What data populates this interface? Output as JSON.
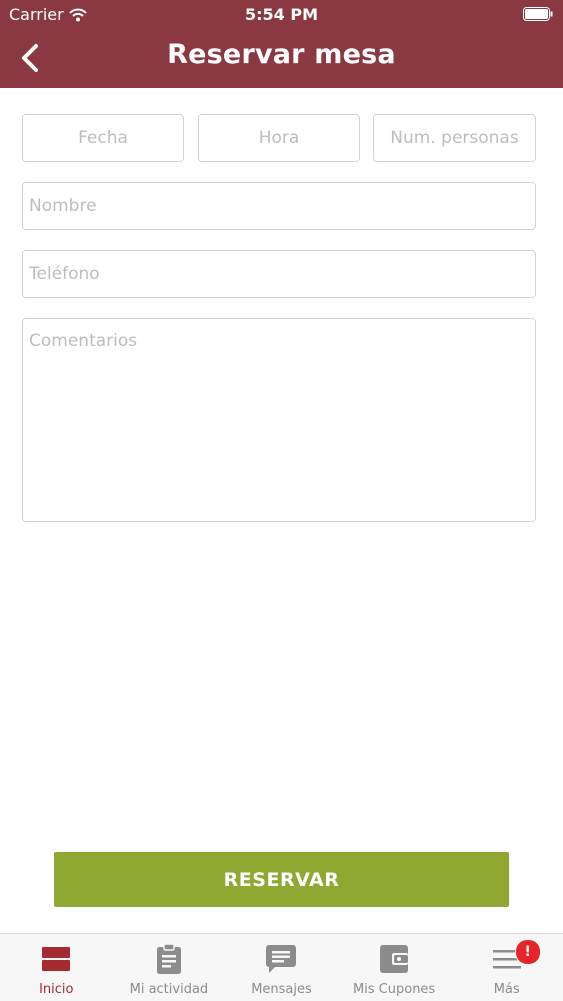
{
  "status_bar": {
    "carrier": "Carrier",
    "time": "5:54 PM"
  },
  "nav": {
    "title": "Reservar mesa"
  },
  "form": {
    "fecha_placeholder": "Fecha",
    "hora_placeholder": "Hora",
    "personas_placeholder": "Num. personas",
    "nombre_placeholder": "Nombre",
    "telefono_placeholder": "Teléfono",
    "comentarios_placeholder": "Comentarios",
    "submit_label": "RESERVAR"
  },
  "tabbar": {
    "items": [
      {
        "label": "Inicio",
        "icon": "home-icon",
        "active": true
      },
      {
        "label": "Mi actividad",
        "icon": "clipboard-icon"
      },
      {
        "label": "Mensajes",
        "icon": "message-icon"
      },
      {
        "label": "Mis Cupones",
        "icon": "wallet-icon"
      },
      {
        "label": "Más",
        "icon": "menu-icon",
        "badge": "!"
      }
    ]
  },
  "colors": {
    "header": "#8a3841",
    "submit": "#8fa832",
    "active_tab": "#a52a32",
    "badge": "#e8242b"
  }
}
